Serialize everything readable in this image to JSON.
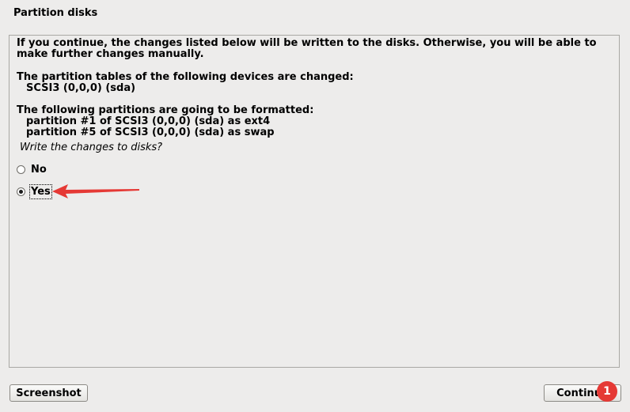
{
  "window": {
    "title": "Partition disks"
  },
  "content": {
    "intro": "If you continue, the changes listed below will be written to the disks. Otherwise, you will be able to make further changes manually.",
    "tables_heading": "The partition tables of the following devices are changed:",
    "tables_devices": [
      "SCSI3 (0,0,0) (sda)"
    ],
    "format_heading": "The following partitions are going to be formatted:",
    "format_partitions": [
      "partition #1 of SCSI3 (0,0,0) (sda) as ext4",
      "partition #5 of SCSI3 (0,0,0) (sda) as swap"
    ],
    "question": "Write the changes to disks?"
  },
  "options": [
    {
      "label": "No",
      "selected": false
    },
    {
      "label": "Yes",
      "selected": true
    }
  ],
  "buttons": {
    "screenshot": "Screenshot",
    "continue": "Continue"
  },
  "annotation": {
    "badge_number": "1",
    "color": "#e53935"
  }
}
